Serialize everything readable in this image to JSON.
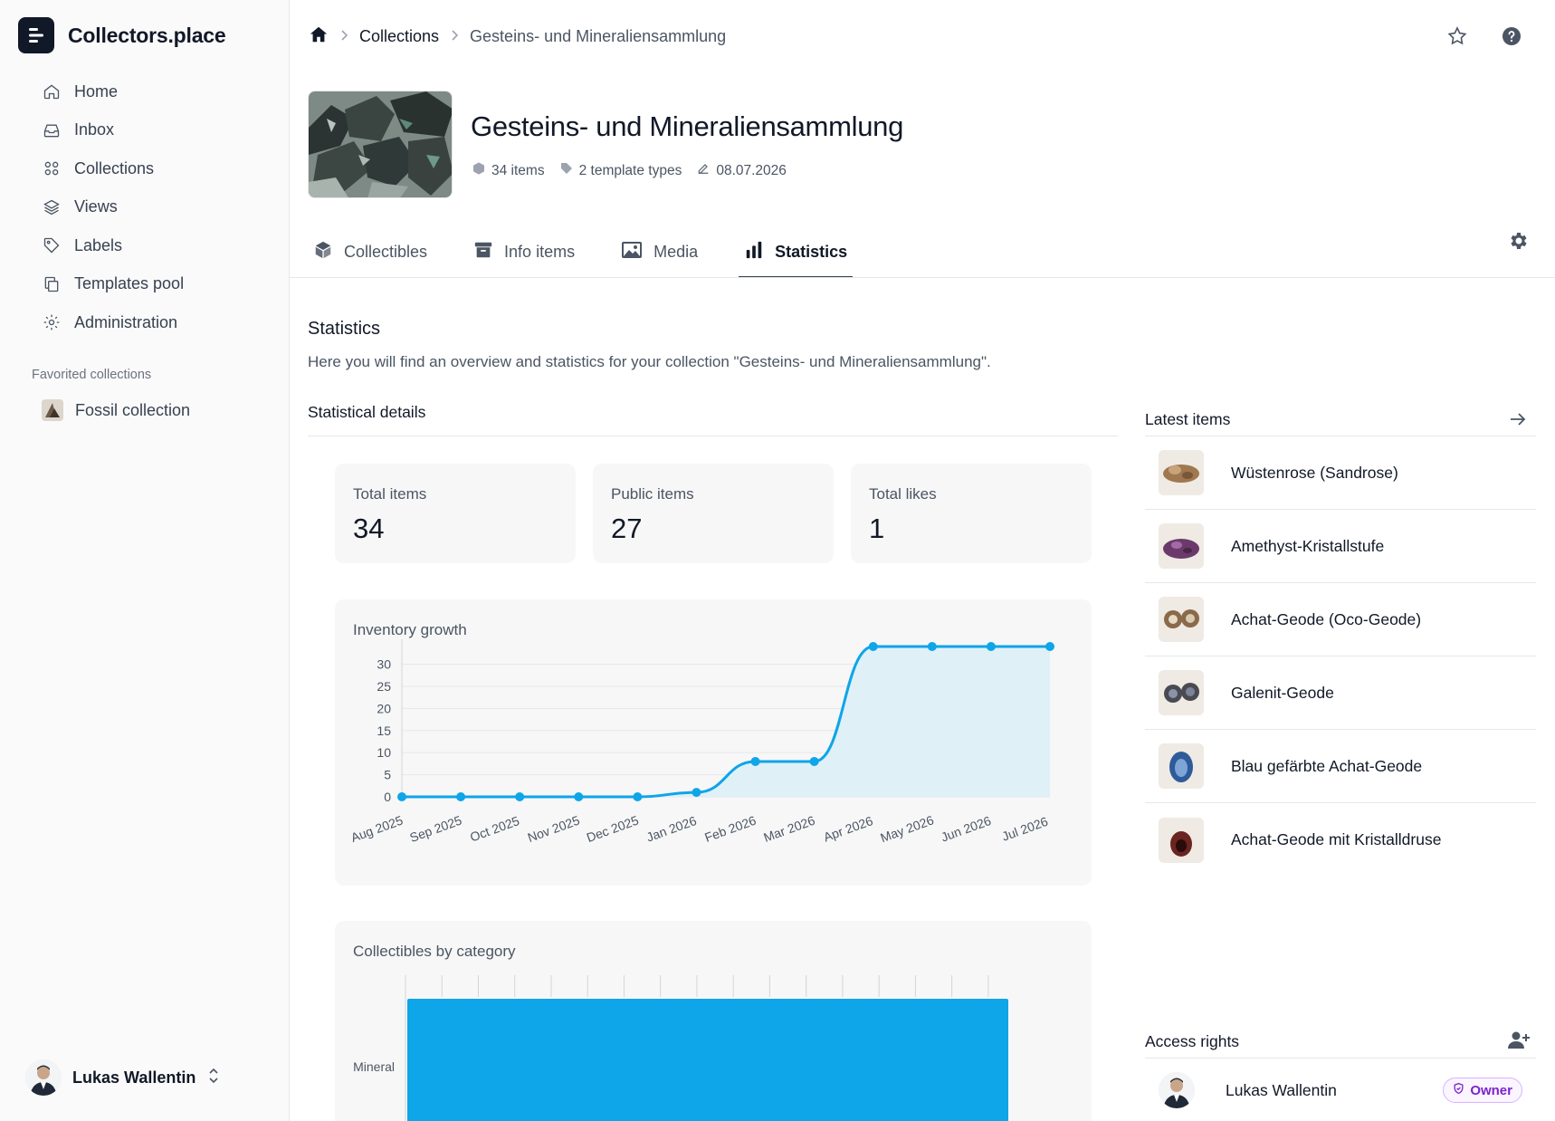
{
  "app": {
    "name": "Collectors.place"
  },
  "sidebar": {
    "items": [
      {
        "label": "Home",
        "icon": "home-icon"
      },
      {
        "label": "Inbox",
        "icon": "inbox-icon"
      },
      {
        "label": "Collections",
        "icon": "grid-icon"
      },
      {
        "label": "Views",
        "icon": "layers-icon"
      },
      {
        "label": "Labels",
        "icon": "tag-icon"
      },
      {
        "label": "Templates pool",
        "icon": "copy-icon"
      },
      {
        "label": "Administration",
        "icon": "gear-icon"
      }
    ],
    "favorites_title": "Favorited collections",
    "favorites": [
      {
        "label": "Fossil collection"
      }
    ],
    "user": {
      "name": "Lukas Wallentin"
    }
  },
  "breadcrumb": {
    "collections": "Collections",
    "current": "Gesteins- und Mineraliensammlung"
  },
  "header": {
    "title": "Gesteins- und Mineraliensammlung",
    "items_count": "34 items",
    "template_types": "2 template types",
    "date": "08.07.2026"
  },
  "tabs": [
    {
      "label": "Collectibles",
      "icon": "box-icon"
    },
    {
      "label": "Info items",
      "icon": "archive-icon"
    },
    {
      "label": "Media",
      "icon": "image-icon"
    },
    {
      "label": "Statistics",
      "icon": "bar-chart-icon",
      "active": true
    }
  ],
  "statistics": {
    "title": "Statistics",
    "description": "Here you will find an overview and statistics for your collection \"Gesteins- und Mineraliensammlung\".",
    "details_title": "Statistical details",
    "cards": [
      {
        "label": "Total items",
        "value": "34"
      },
      {
        "label": "Public items",
        "value": "27"
      },
      {
        "label": "Total likes",
        "value": "1"
      }
    ]
  },
  "chart_data": [
    {
      "type": "area",
      "title": "Inventory growth",
      "x": [
        "Aug 2025",
        "Sep 2025",
        "Oct 2025",
        "Nov 2025",
        "Dec 2025",
        "Jan 2026",
        "Feb 2026",
        "Mar 2026",
        "Apr 2026",
        "May 2026",
        "Jun 2026",
        "Jul 2026"
      ],
      "values": [
        0,
        0,
        0,
        0,
        0,
        1,
        8,
        8,
        34,
        34,
        34,
        34
      ],
      "yticks": [
        0,
        5,
        10,
        15,
        20,
        25,
        30
      ],
      "ylim": [
        0,
        34
      ],
      "grid": true,
      "color": "#0ea5e9",
      "fill": "#dff0f7"
    },
    {
      "type": "bar",
      "orientation": "horizontal",
      "title": "Collectibles by category",
      "categories": [
        "Mineral"
      ],
      "values": [
        34
      ],
      "xlim": [
        0,
        34
      ],
      "color": "#0ea5e9"
    }
  ],
  "latest": {
    "title": "Latest items",
    "items": [
      {
        "name": "Wüstenrose (Sandrose)",
        "color": "#a07850"
      },
      {
        "name": "Amethyst-Kristallstufe",
        "color": "#6b3a6b"
      },
      {
        "name": "Achat-Geode (Oco-Geode)",
        "color": "#8a6a4a"
      },
      {
        "name": "Galenit-Geode",
        "color": "#4a4a52"
      },
      {
        "name": "Blau gefärbte Achat-Geode",
        "color": "#2e5c9a"
      },
      {
        "name": "Achat-Geode mit Kristalldruse",
        "color": "#6b2420"
      }
    ]
  },
  "access": {
    "title": "Access rights",
    "users": [
      {
        "name": "Lukas Wallentin",
        "role": "Owner"
      }
    ]
  }
}
